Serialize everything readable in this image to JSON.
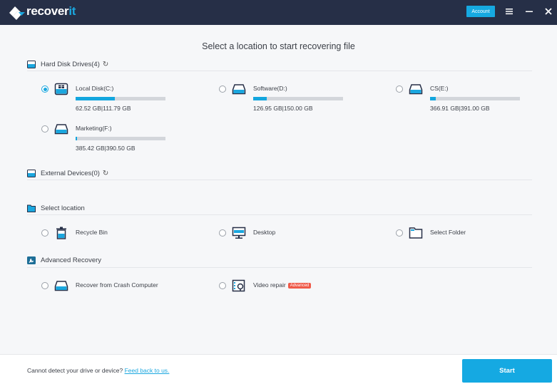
{
  "app": {
    "brand_main": "recover",
    "brand_accent": "it",
    "account_label": "Account",
    "colors": {
      "titlebar": "#262f47",
      "accent": "#1ba7df",
      "badge": "#ef5a49"
    }
  },
  "titlebar_icons": [
    "menu-icon",
    "minimize-icon",
    "close-icon"
  ],
  "main": {
    "title": "Select a location to start recovering file"
  },
  "sections": {
    "hard_disk": {
      "label": "Hard Disk Drives(4)",
      "drives": [
        {
          "name": "Local Disk(C:)",
          "size": "62.52  GB|111.79  GB",
          "used_fraction": 0.44,
          "selected": true,
          "icon": "system-drive-icon"
        },
        {
          "name": "Software(D:)",
          "size": "126.95  GB|150.00  GB",
          "used_fraction": 0.15,
          "selected": false,
          "icon": "drive-icon"
        },
        {
          "name": "CS(E:)",
          "size": "366.91  GB|391.00  GB",
          "used_fraction": 0.06,
          "selected": false,
          "icon": "drive-icon"
        },
        {
          "name": "Marketing(F:)",
          "size": "385.42  GB|390.50  GB",
          "used_fraction": 0.01,
          "selected": false,
          "icon": "drive-icon"
        }
      ]
    },
    "external": {
      "label": "External Devices(0)"
    },
    "select_location": {
      "label": "Select location",
      "items": [
        {
          "name": "Recycle Bin",
          "icon": "recycle-bin-icon"
        },
        {
          "name": "Desktop",
          "icon": "desktop-icon"
        },
        {
          "name": "Select Folder",
          "icon": "folder-icon"
        }
      ]
    },
    "advanced": {
      "label": "Advanced Recovery",
      "items": [
        {
          "name": "Recover from Crash Computer",
          "icon": "crash-computer-icon"
        },
        {
          "name": "Video repair",
          "badge": "Advanced",
          "icon": "video-repair-icon"
        }
      ]
    }
  },
  "footer": {
    "text": "Cannot detect your drive or device? ",
    "link": "Feed back to us.",
    "start_label": "Start"
  }
}
